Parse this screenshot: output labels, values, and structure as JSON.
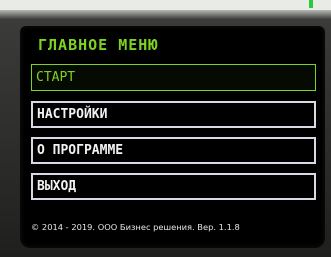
{
  "screen": {
    "title": "ГЛАВНОЕ МЕНЮ",
    "accent_color": "#7ed321",
    "menu_items": [
      {
        "label": "СТАРТ",
        "selected": true
      },
      {
        "label": "НАСТРОЙКИ",
        "selected": false
      },
      {
        "label": "О ПРОГРАММЕ",
        "selected": false
      },
      {
        "label": "ВЫХОД",
        "selected": false
      }
    ],
    "footer": "© 2014 - 2019. ООО Бизнес решения. Вер. 1.1.8"
  },
  "status_led_color": "#27c93f"
}
